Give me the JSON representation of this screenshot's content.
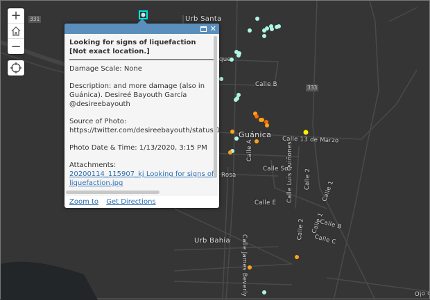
{
  "map": {
    "labels": {
      "urb_santa": "Urb Santa",
      "guanica": "Guánica",
      "urb_bahia": "Urb Bahia",
      "calle_b": "Calle B",
      "calle_13": "Calle 13 de Marzo",
      "calle_a": "Calle A",
      "calle_sol": "Calle Sol",
      "rosa": "Rosa",
      "calle_e": "Calle E",
      "calle_luis": "Calle Luis Quiñones",
      "calle_2a": "Calle 2",
      "calle_2b": "Calle 2",
      "calle_1a": "Calle 1",
      "calle_1b": "Calle 1",
      "calle_b2": "Calle B",
      "calle_c": "Calle C",
      "calle_james": "Calle James Beverly",
      "ojo": "Ojo de",
      "que": "que"
    },
    "shields": {
      "r331": "331",
      "r333": "333"
    },
    "colors": {
      "none": "#aef5e4",
      "minor": "#ffa319",
      "moderate": "#ff6a00",
      "yellow": "#ffee00",
      "selected": "#00e5e5"
    }
  },
  "controls": {
    "zoom_in": "+",
    "zoom_out": "−"
  },
  "popup": {
    "title": "Looking for signs of liquefaction [Not exact location.]",
    "damage": "Damage Scale: None",
    "description_1": "Description: and more damage (also in",
    "description_2": "Guánica). Desireé Bayouth García",
    "description_3": "@desireebayouth",
    "source_label": "Source of Photo:",
    "source_url": "https://twitter.com/desireebayouth/status/1",
    "date": "Photo Date & Time: 1/13/2020, 3:15 PM",
    "attachments_label": "Attachments:",
    "attachment_1": "20200114_115907_kj Looking for signs of",
    "attachment_2": "liquefaction.jpg",
    "zoom_to": "Zoom to",
    "get_directions": "Get Directions"
  }
}
